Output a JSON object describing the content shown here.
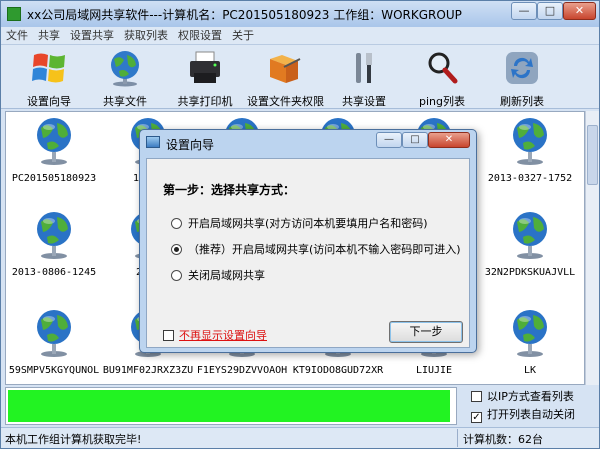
{
  "window": {
    "title": "xx公司局域网共享软件---计算机名：PC201505180923  工作组：WORKGROUP",
    "min": "—",
    "max": "□",
    "close": "✕"
  },
  "menu": [
    "文件",
    "共享",
    "设置共享",
    "获取列表",
    "权限设置",
    "关于"
  ],
  "toolbar": [
    {
      "label": "设置向导",
      "icon": "windows-flag-icon"
    },
    {
      "label": "共享文件",
      "icon": "globe-icon"
    },
    {
      "label": "共享打印机",
      "icon": "printer-icon"
    },
    {
      "label": "设置文件夹权限",
      "icon": "folder-key-icon"
    },
    {
      "label": "共享设置",
      "icon": "tools-icon"
    },
    {
      "label": "ping列表",
      "icon": "magnifier-icon"
    },
    {
      "label": "刷新列表",
      "icon": "refresh-icon"
    }
  ],
  "computers": [
    [
      "PC201505180923",
      "1XWZU",
      "",
      "",
      "",
      "2013-0327-1752"
    ],
    [
      "2013-0806-1245",
      "2013",
      "",
      "",
      "",
      "32N2PDKSKUAJVLL"
    ],
    [
      "59SMPV5KGYQUNOL",
      "BU91MF02JRXZ3ZU",
      "F1EYS29DZVVOAOH",
      "KT9IODO8GUD72XR",
      "LIUJIE",
      "LK"
    ]
  ],
  "progress": {
    "fraction": 0.99
  },
  "options": [
    {
      "label": "以IP方式查看列表",
      "checked": false
    },
    {
      "label": "打开列表自动关闭",
      "checked": true
    }
  ],
  "check_mark": "✓",
  "status": {
    "left": "本机工作组计算机获取完毕!",
    "right": "计算机数：62台"
  },
  "dialog": {
    "title": "设置向导",
    "step": "第一步：选择共享方式：",
    "options": [
      {
        "label": "开启局域网共享(对方访问本机要填用户名和密码)",
        "selected": false
      },
      {
        "label": "（推荐）开启局域网共享(访问本机不输入密码即可进入)",
        "selected": true
      },
      {
        "label": "关闭局域网共享",
        "selected": false
      }
    ],
    "noshow": "不再显示设置向导",
    "next": "下一步",
    "min": "—",
    "max": "□",
    "close": "✕"
  },
  "colors": {
    "progress": "#22f322",
    "accent": "#2e6fc0"
  }
}
